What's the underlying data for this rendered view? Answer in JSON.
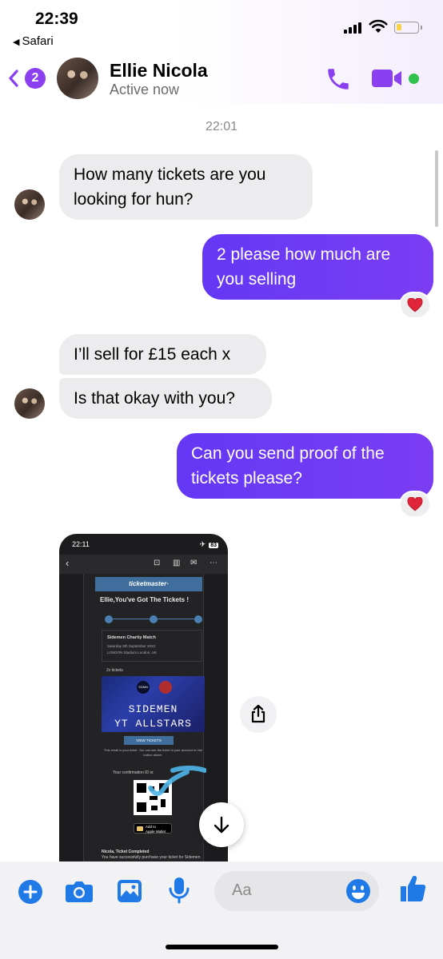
{
  "status_bar": {
    "time": "22:39",
    "back_app": "Safari"
  },
  "header": {
    "unread_count": "2",
    "contact_name": "Ellie Nicola",
    "contact_status": "Active now",
    "accent_color": "#8a3ff0"
  },
  "conversation": {
    "timestamp": "22:01",
    "messages": [
      {
        "direction": "incoming",
        "lines": [
          "How many tickets are you",
          "looking for hun?"
        ]
      },
      {
        "direction": "outgoing",
        "lines": [
          "2 please how much are",
          "you selling"
        ],
        "reaction": "red-heart"
      },
      {
        "direction": "incoming",
        "lines": [
          "I’ll sell for £15 each x"
        ]
      },
      {
        "direction": "incoming",
        "lines": [
          "Is that okay with you?"
        ]
      },
      {
        "direction": "outgoing",
        "lines": [
          "Can you send proof of the",
          "tickets please?"
        ],
        "reaction": "red-heart"
      }
    ]
  },
  "attachment": {
    "time": "22:11",
    "battery": "83",
    "email": {
      "brand": "ticketmaster·",
      "title": "Ellie,You've Got The Tickets !",
      "event_title": "Sidemen Charity Match",
      "event_date": "Saturday 9th September 2023",
      "event_venue": "LONDON Stadium  London, UK",
      "ticket_count": "2x tickets",
      "banner_line1": "SIDEMEN",
      "banner_line2": "YT ALLSTARS",
      "banner_logo": "SDMN",
      "view_button": "VIEW TICKETS",
      "note": "This email is your ticket. You can see the ticket in your account on the button above.",
      "confirmation": "Your confirmation ID is:",
      "wallet_small": "Add to",
      "wallet_label": "Apple Wallet",
      "footer_title": "Nicola, Ticket Completed",
      "footer_text": "You have successfully purchase your ticket for Sidemen"
    }
  },
  "composer": {
    "placeholder": "Aa"
  },
  "colors": {
    "outgoing_bubble": "#6e33f5",
    "incoming_bubble": "#ececee",
    "icon_blue": "#1f7ae8",
    "online": "#31c24d"
  }
}
